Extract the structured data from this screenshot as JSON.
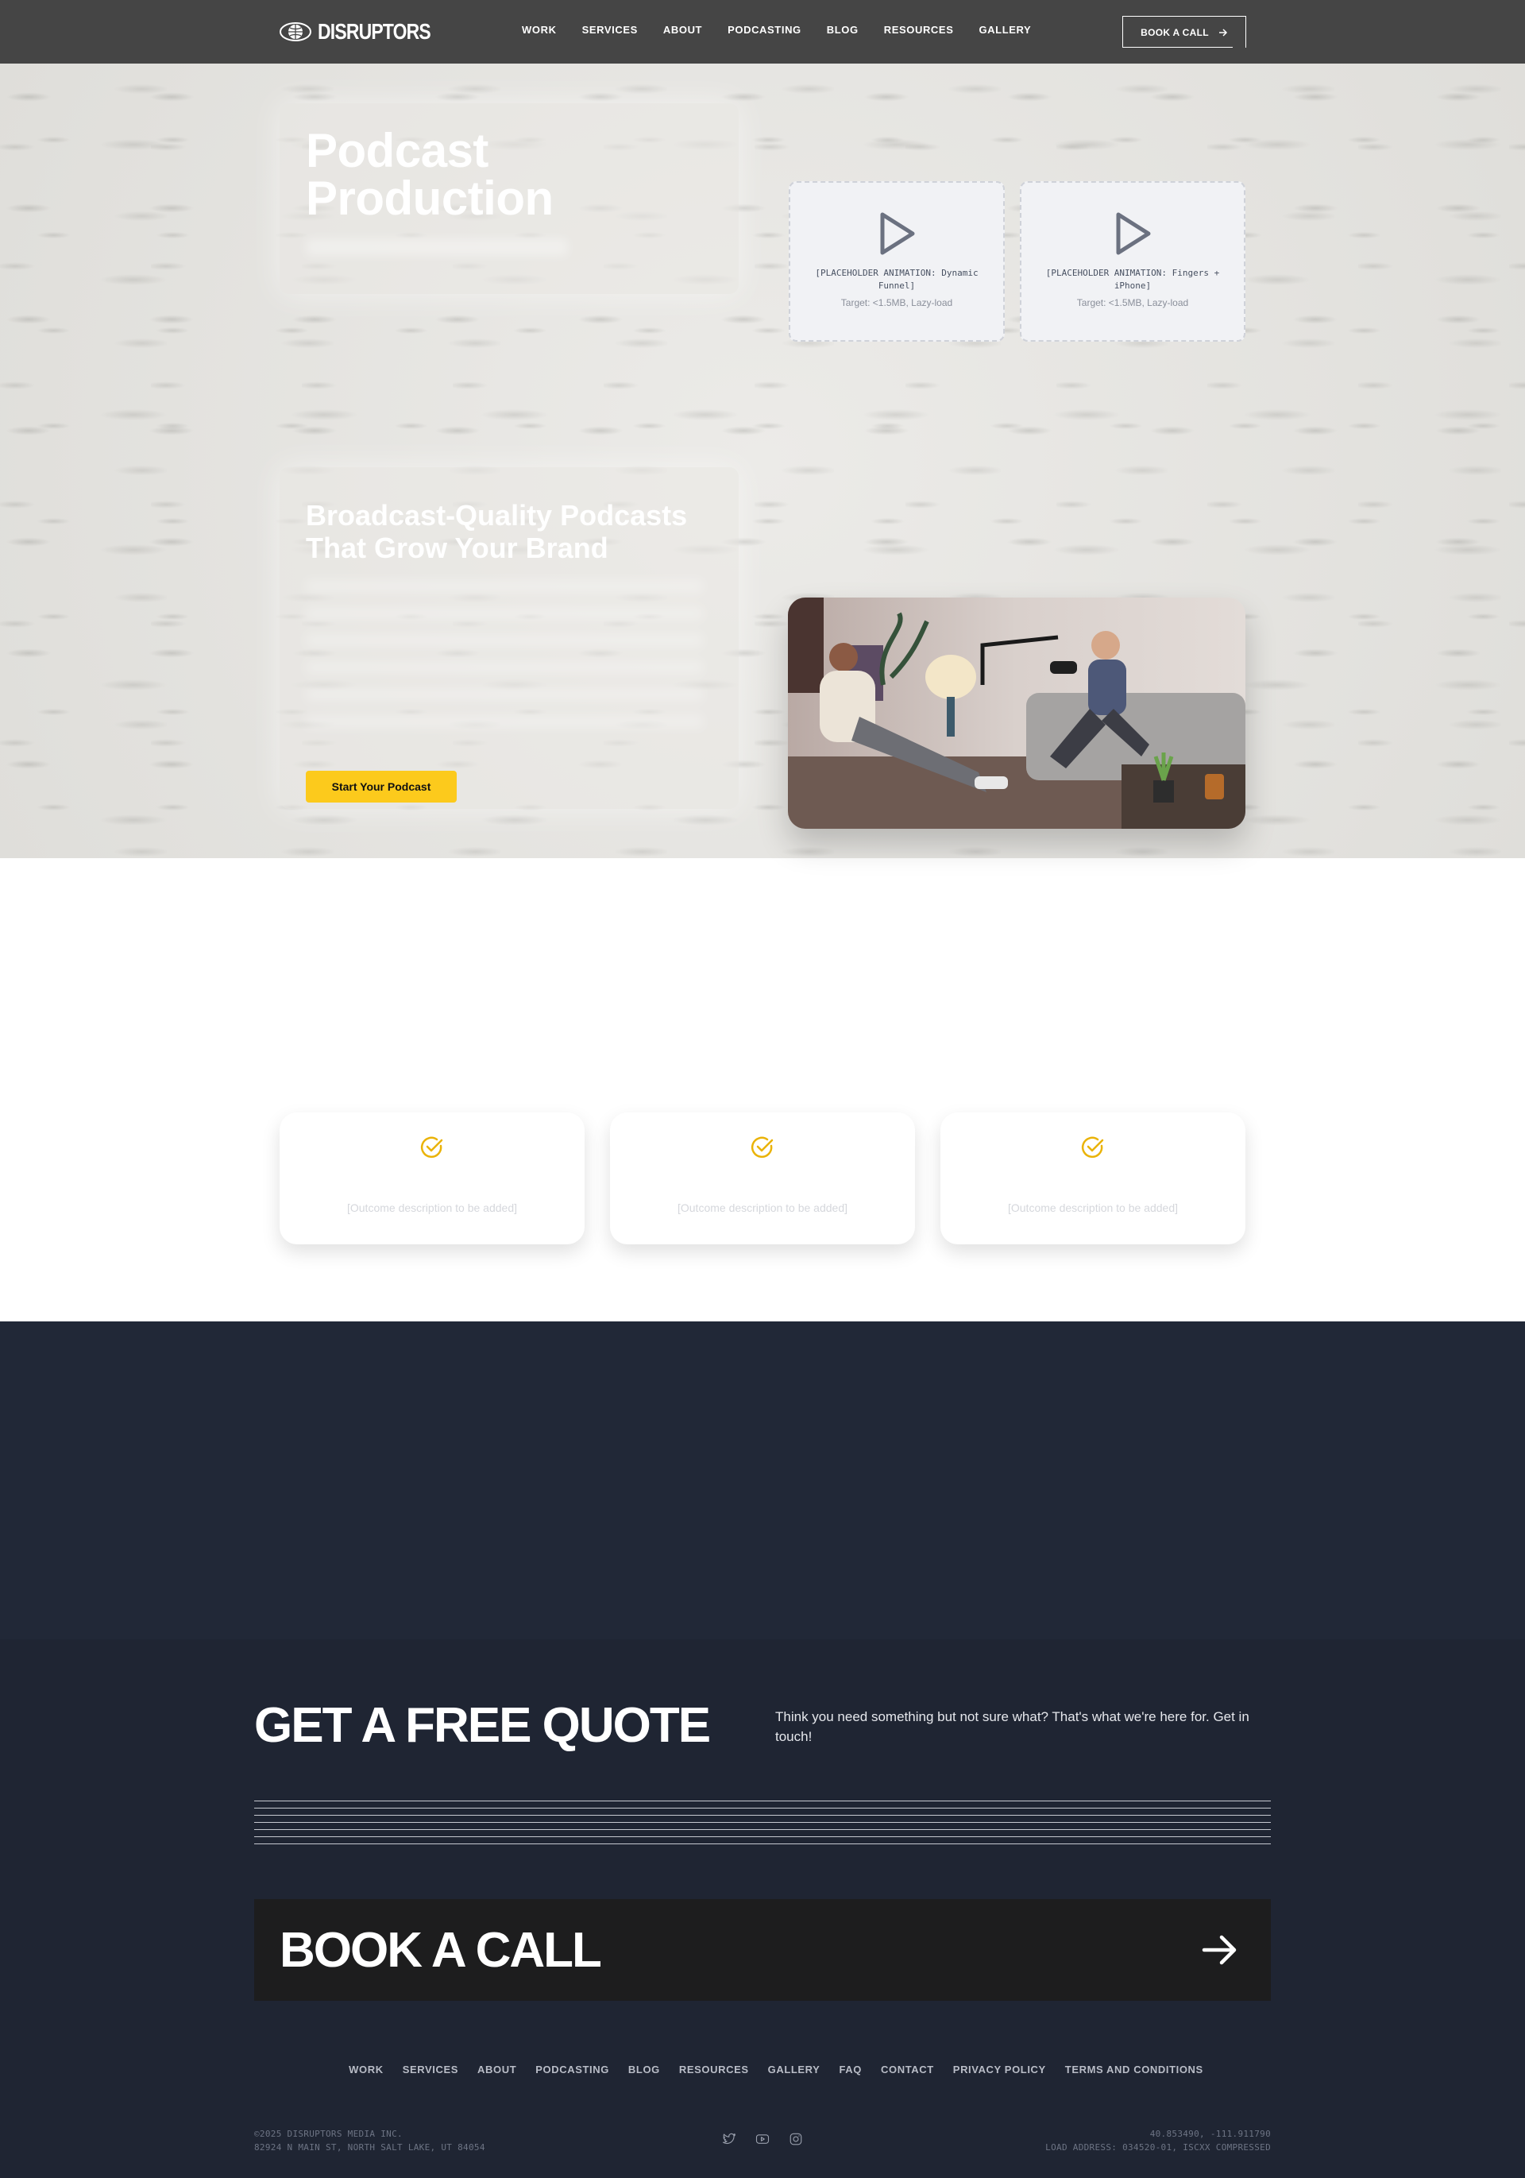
{
  "nav": {
    "brand": "DISRUPTORS",
    "items": [
      "WORK",
      "SERVICES",
      "ABOUT",
      "PODCASTING",
      "BLOG",
      "RESOURCES",
      "GALLERY"
    ],
    "cta": "BOOK A CALL"
  },
  "hero": {
    "title_line1": "Podcast",
    "title_line2": "Production",
    "placeholders": [
      {
        "title": "[PLACEHOLDER ANIMATION: Dynamic Funnel]",
        "target": "Target: <1.5MB, Lazy-load"
      },
      {
        "title": "[PLACEHOLDER ANIMATION: Fingers + iPhone]",
        "target": "Target: <1.5MB, Lazy-load"
      }
    ],
    "headline_line1": "Broadcast-Quality Podcasts",
    "headline_line2": "That Grow Your Brand",
    "cta": "Start Your Podcast"
  },
  "outcomes": [
    {
      "text": "[Outcome description to be added]"
    },
    {
      "text": "[Outcome description to be added]"
    },
    {
      "text": "[Outcome description to be added]"
    }
  ],
  "quote": {
    "heading": "GET A FREE QUOTE",
    "text": "Think you need something but not sure what? That's what we're here for. Get in touch!",
    "book": "BOOK A CALL"
  },
  "footer": {
    "links": [
      "WORK",
      "SERVICES",
      "ABOUT",
      "PODCASTING",
      "BLOG",
      "RESOURCES",
      "GALLERY",
      "FAQ",
      "CONTACT",
      "PRIVACY POLICY",
      "TERMS AND CONDITIONS"
    ],
    "copyright": "©2025 DISRUPTORS MEDIA INC.",
    "address": "82924 N MAIN ST, NORTH SALT LAKE, UT 84054",
    "coords": "40.853490, -111.911790",
    "load_address": "LOAD ADDRESS: 034520-01, ISCXX COMPRESSED",
    "social_icons": [
      "twitter-icon",
      "youtube-icon",
      "instagram-icon"
    ]
  },
  "colors": {
    "nav_bg": "#454545",
    "accent": "#fcca1c",
    "dark_bg": "#212837"
  }
}
